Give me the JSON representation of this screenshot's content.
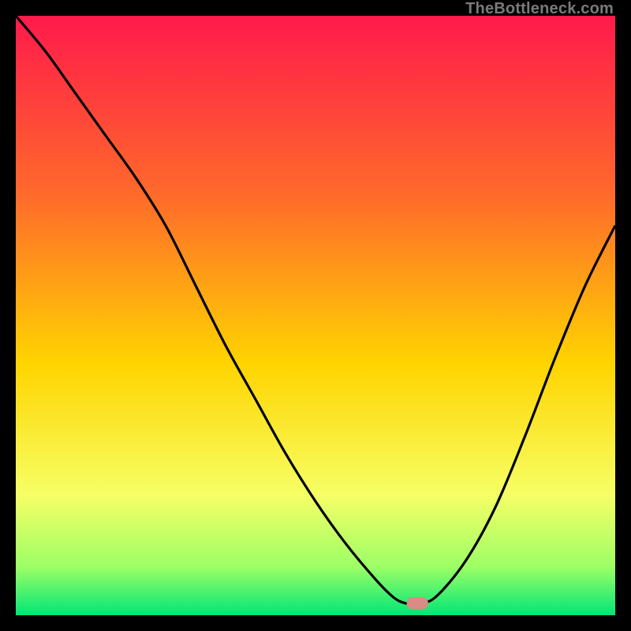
{
  "watermark": "TheBottleneck.com",
  "colors": {
    "frame": "#000000",
    "gradient_top": "#ff1a4b",
    "gradient_mid1": "#ff6a2a",
    "gradient_mid2": "#ffd400",
    "gradient_low": "#f6ff66",
    "gradient_green_light": "#9cff66",
    "gradient_green": "#00e676",
    "curve": "#000000",
    "marker_fill": "#d98b85",
    "marker_stroke": "#d98b85"
  },
  "chart_data": {
    "type": "line",
    "title": "",
    "xlabel": "",
    "ylabel": "",
    "xlim": [
      0,
      100
    ],
    "ylim": [
      0,
      100
    ],
    "annotations": [
      {
        "kind": "marker",
        "x": 67,
        "y": 2,
        "shape": "rounded-rect"
      }
    ],
    "series": [
      {
        "name": "bottleneck-curve",
        "x": [
          0,
          5,
          10,
          15,
          20,
          25,
          30,
          35,
          40,
          45,
          50,
          55,
          60,
          63,
          65,
          67,
          70,
          75,
          80,
          85,
          90,
          95,
          100
        ],
        "y": [
          100,
          94,
          87,
          80,
          73,
          65,
          55,
          45,
          36,
          27,
          19,
          12,
          6,
          3,
          2,
          2,
          3,
          9,
          18,
          30,
          43,
          55,
          65
        ]
      }
    ],
    "background": {
      "type": "vertical-gradient",
      "stops": [
        {
          "pos": 0.0,
          "color": "#ff1a4b"
        },
        {
          "pos": 0.3,
          "color": "#ff6a2a"
        },
        {
          "pos": 0.58,
          "color": "#ffd400"
        },
        {
          "pos": 0.8,
          "color": "#f6ff66"
        },
        {
          "pos": 0.92,
          "color": "#9cff66"
        },
        {
          "pos": 1.0,
          "color": "#00e676"
        }
      ]
    }
  }
}
